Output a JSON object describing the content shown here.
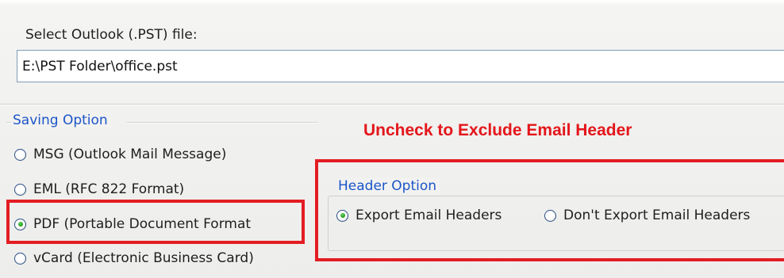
{
  "file_select": {
    "label": "Select Outlook (.PST) file:",
    "value": "E:\\PST Folder\\office.pst"
  },
  "saving_option": {
    "title": "Saving Option",
    "options": [
      {
        "label": "MSG (Outlook Mail Message)",
        "checked": false
      },
      {
        "label": "EML (RFC 822 Format)",
        "checked": false
      },
      {
        "label": "PDF (Portable Document Format",
        "checked": true
      },
      {
        "label": "vCard (Electronic Business Card)",
        "checked": false
      }
    ]
  },
  "annotation": {
    "text": "Uncheck to Exclude Email Header",
    "color": "#e4161b"
  },
  "header_option": {
    "title": "Header Option",
    "options": [
      {
        "label": "Export Email Headers",
        "checked": true
      },
      {
        "label": "Don't Export Email Headers",
        "checked": false
      }
    ]
  },
  "colors": {
    "group_title": "#1c55c8",
    "highlight_border": "#e31d23",
    "radio_checked": "#21a11c"
  },
  "icons": {
    "radio_unchecked": "radio-unchecked-icon",
    "radio_checked": "radio-checked-icon"
  }
}
